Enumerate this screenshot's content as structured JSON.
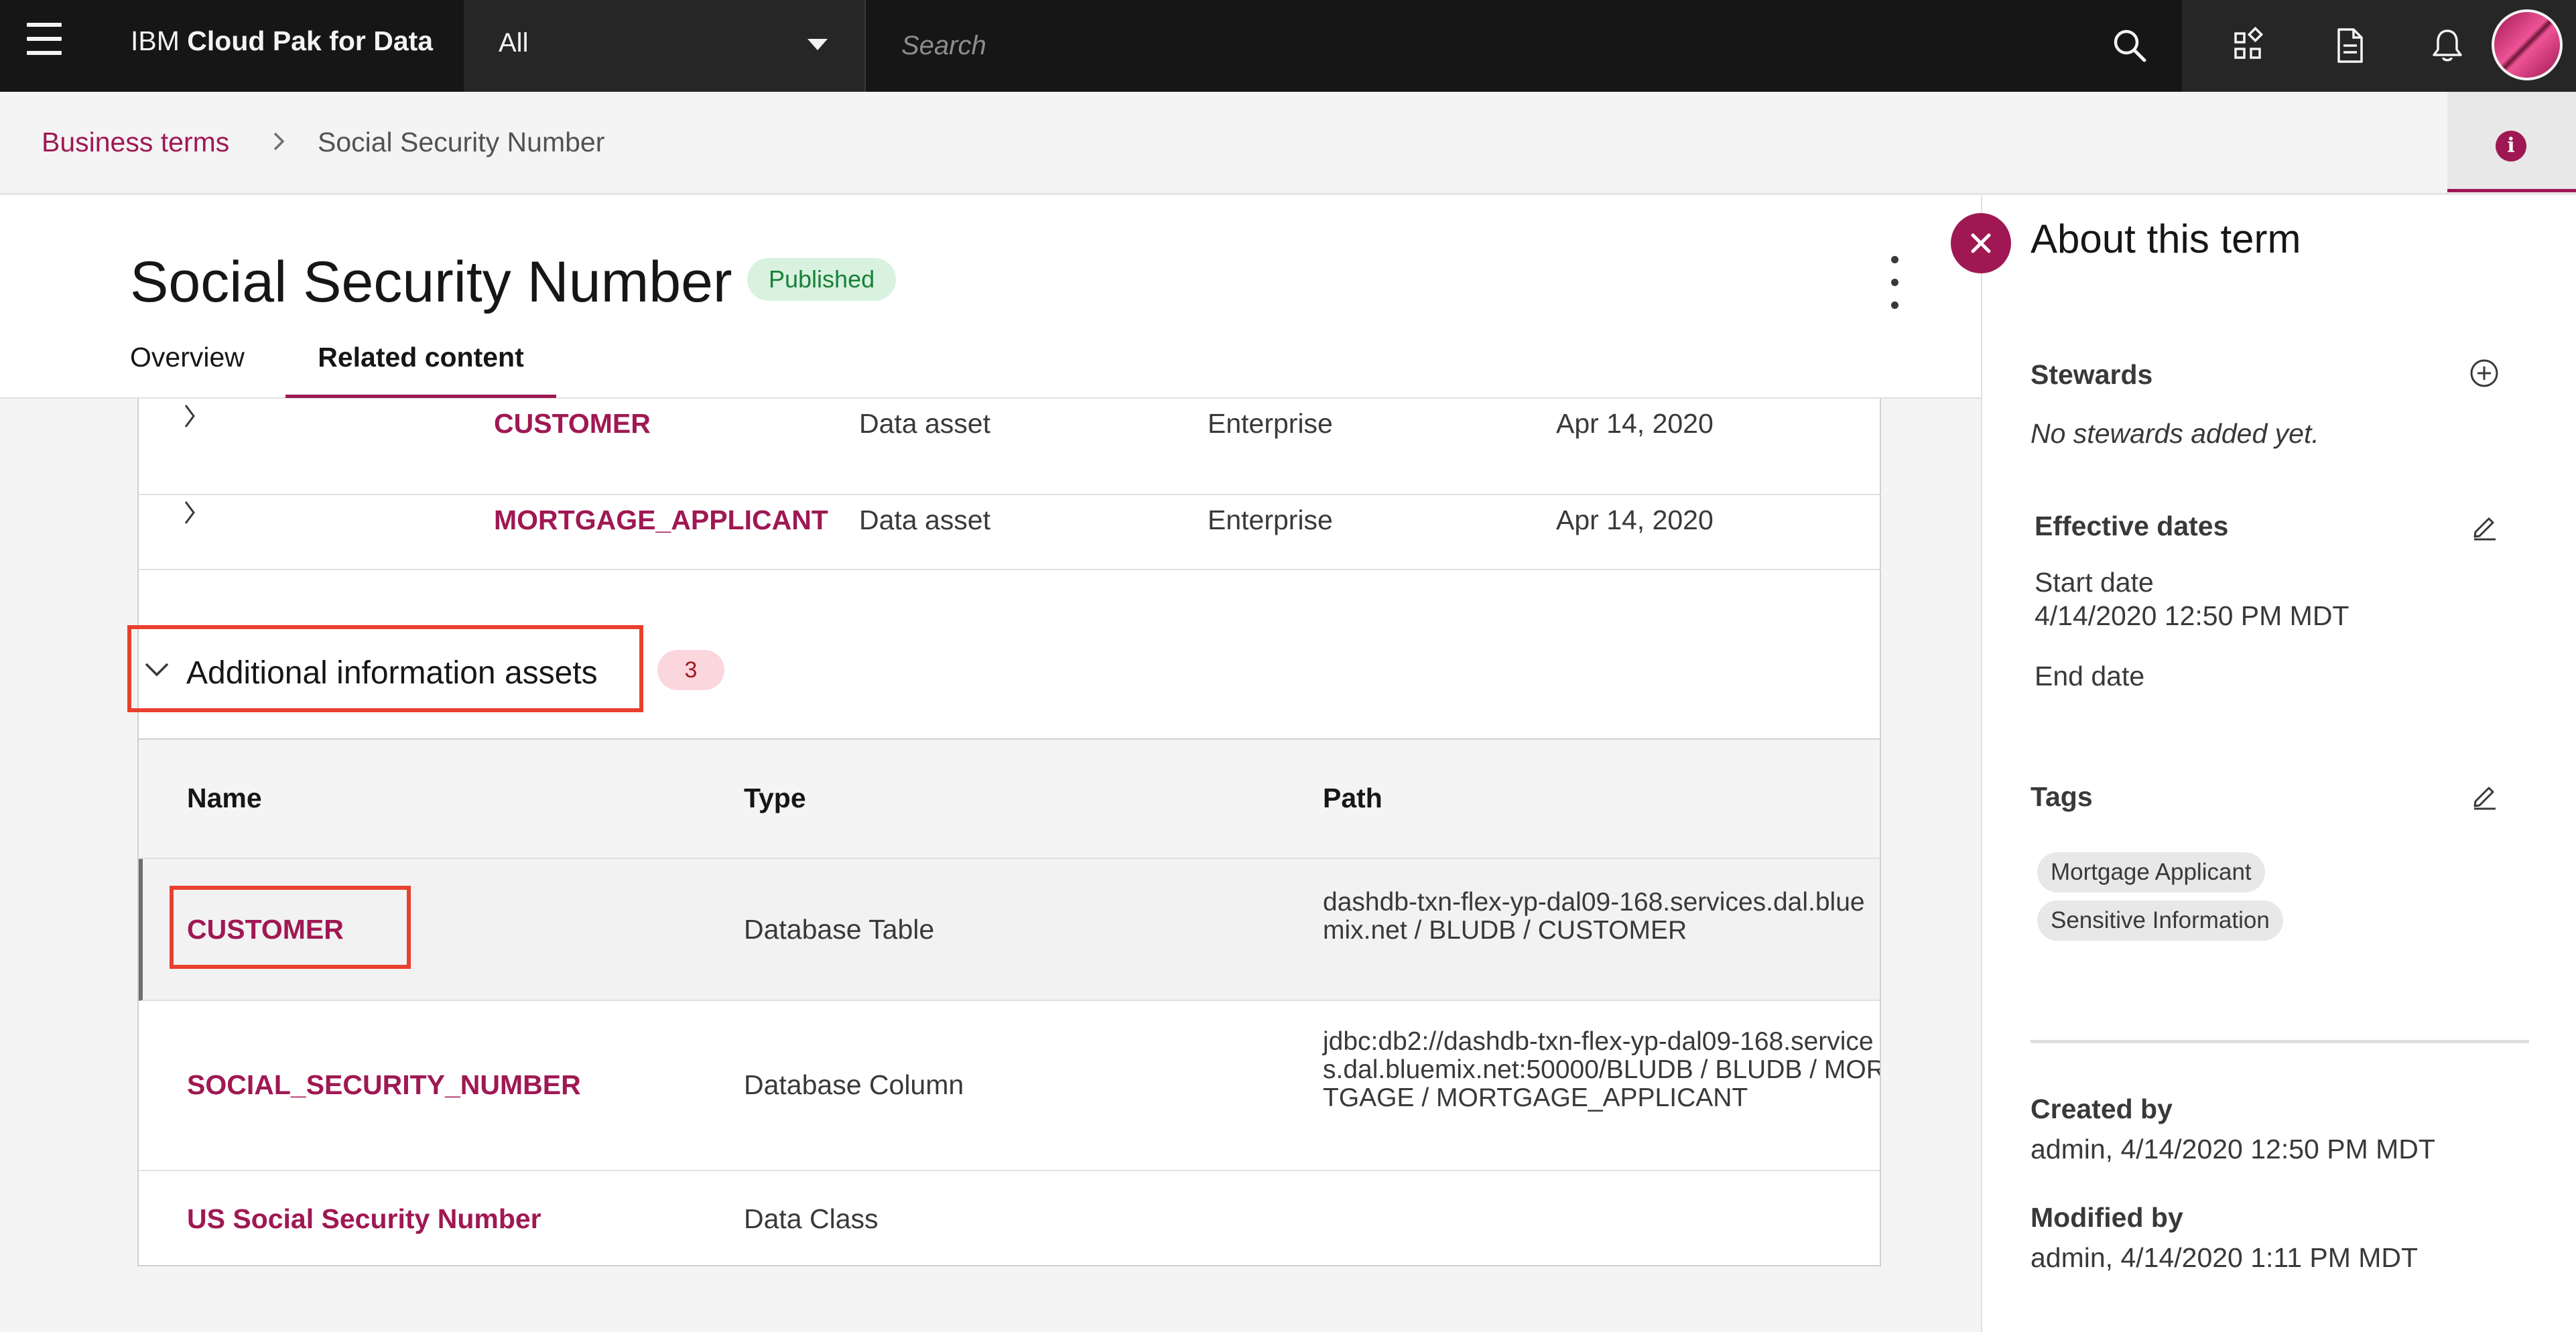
{
  "header": {
    "brand_prefix": "IBM ",
    "brand_name": "Cloud Pak for Data",
    "scope_value": "All",
    "search_placeholder": "Search"
  },
  "breadcrumb": {
    "parent": "Business terms",
    "current": "Social Security Number"
  },
  "term": {
    "title": "Social Security Number",
    "status": "Published",
    "tabs": [
      "Overview",
      "Related content"
    ]
  },
  "related_rows": [
    {
      "name": "CUSTOMER",
      "type": "Data asset",
      "scope": "Enterprise",
      "date": "Apr 14, 2020"
    },
    {
      "name": "MORTGAGE_APPLICANT",
      "type": "Data asset",
      "scope": "Enterprise",
      "date": "Apr 14, 2020"
    }
  ],
  "additional": {
    "title": "Additional information assets",
    "count": "3",
    "columns": [
      "Name",
      "Type",
      "Path"
    ],
    "rows": [
      {
        "name": "CUSTOMER",
        "type": "Database Table",
        "path": "dashdb-txn-flex-yp-dal09-168.services.dal.bluemix.net / BLUDB / CUSTOMER"
      },
      {
        "name": "SOCIAL_SECURITY_NUMBER",
        "type": "Database Column",
        "path": "jdbc:db2://dashdb-txn-flex-yp-dal09-168.services.dal.bluemix.net:50000/BLUDB / BLUDB / MORTGAGE / MORTGAGE_APPLICANT"
      },
      {
        "name": "US Social Security Number",
        "type": "Data Class",
        "path": ""
      }
    ]
  },
  "panel": {
    "title": "About this term",
    "stewards_label": "Stewards",
    "stewards_empty": "No stewards added yet.",
    "effective_label": "Effective dates",
    "start_label": "Start date",
    "start_value": "4/14/2020 12:50 PM MDT",
    "end_label": "End date",
    "tags_label": "Tags",
    "tags": [
      "Mortgage Applicant",
      "Sensitive Information"
    ],
    "created_label": "Created by",
    "created_value": "admin, 4/14/2020 12:50 PM MDT",
    "modified_label": "Modified by",
    "modified_value": "admin, 4/14/2020 1:11 PM MDT"
  },
  "colors": {
    "accent": "#9f1853",
    "highlight": "#e8402e",
    "status_green": "#198038",
    "header_bg": "#161616"
  },
  "icons": [
    "menu-icon",
    "chevron-down-icon",
    "search-icon",
    "apps-icon",
    "document-icon",
    "notification-icon",
    "avatar",
    "chevron-right-icon",
    "info-icon",
    "overflow-menu-icon",
    "close-icon",
    "add-icon",
    "edit-icon"
  ]
}
